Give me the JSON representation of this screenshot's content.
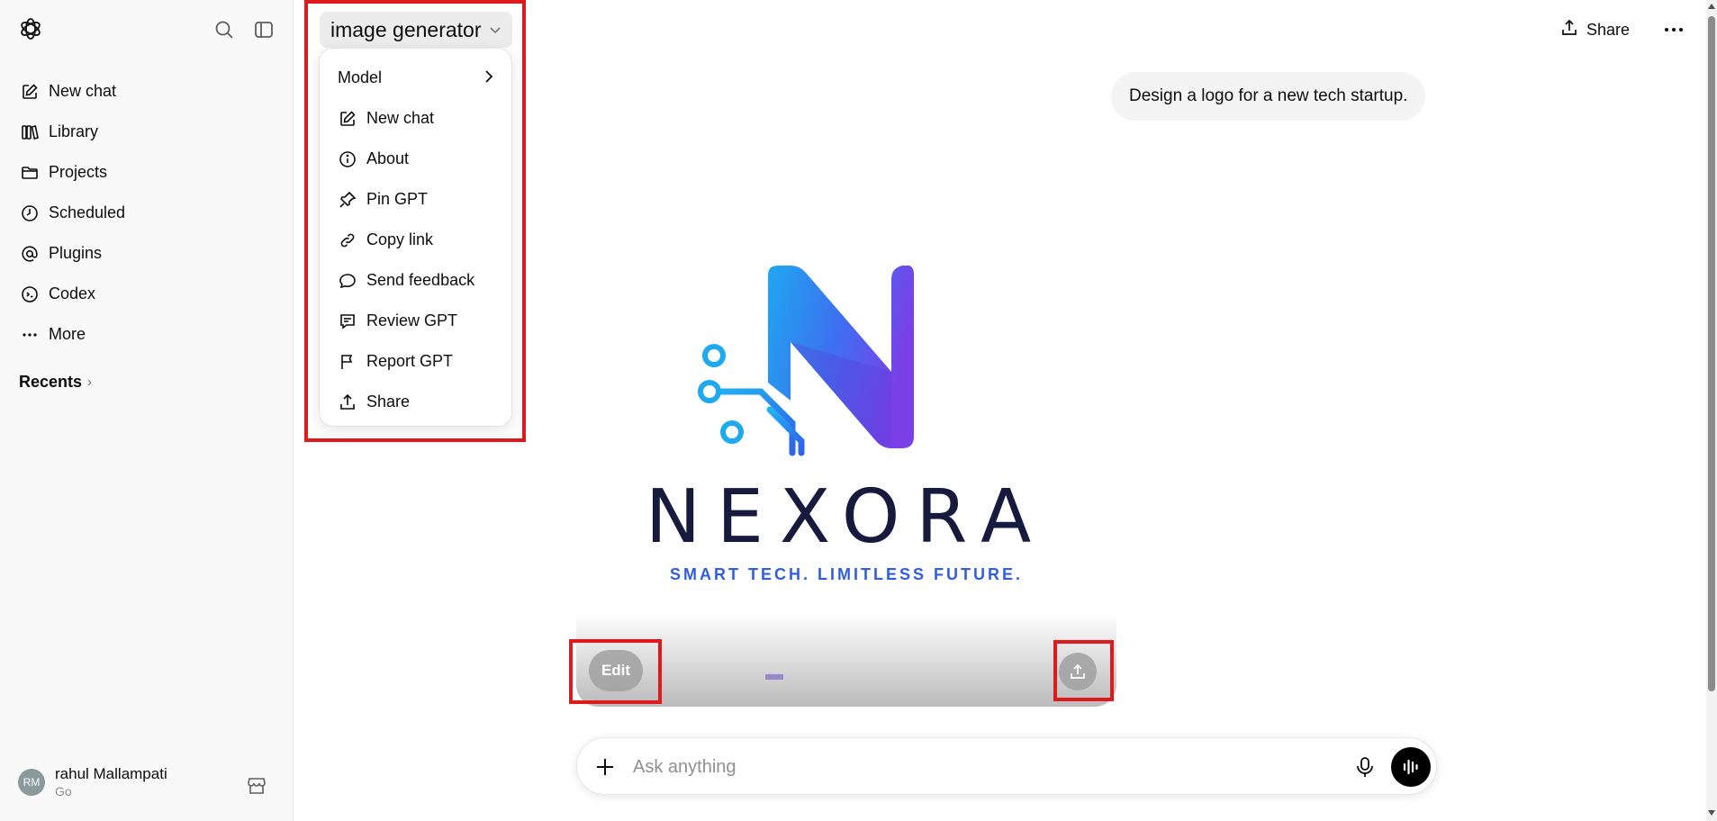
{
  "sidebar": {
    "items": [
      {
        "label": "New chat",
        "icon": "compose-icon"
      },
      {
        "label": "Library",
        "icon": "library-icon"
      },
      {
        "label": "Projects",
        "icon": "folder-icon"
      },
      {
        "label": "Scheduled",
        "icon": "clock-icon"
      },
      {
        "label": "Plugins",
        "icon": "at-icon"
      },
      {
        "label": "Codex",
        "icon": "codex-icon"
      },
      {
        "label": "More",
        "icon": "more-dots-icon"
      }
    ],
    "recents_label": "Recents",
    "user": {
      "initials": "RM",
      "name": "rahul Mallampati",
      "plan": "Go"
    }
  },
  "header": {
    "gpt_title": "image generator",
    "share_label": "Share"
  },
  "menu": {
    "items": [
      {
        "label": "Model",
        "icon": "none"
      },
      {
        "label": "New chat",
        "icon": "compose-icon"
      },
      {
        "label": "About",
        "icon": "info-icon"
      },
      {
        "label": "Pin GPT",
        "icon": "pin-icon"
      },
      {
        "label": "Copy link",
        "icon": "link-icon"
      },
      {
        "label": "Send feedback",
        "icon": "chat-bubble-icon"
      },
      {
        "label": "Review GPT",
        "icon": "review-icon"
      },
      {
        "label": "Report GPT",
        "icon": "flag-icon"
      },
      {
        "label": "Share",
        "icon": "upload-icon"
      }
    ]
  },
  "conversation": {
    "user_message": "Design a logo for a new tech startup.",
    "image": {
      "brand": "NEXORA",
      "tagline": "SMART TECH. LIMITLESS FUTURE.",
      "edit_label": "Edit"
    }
  },
  "composer": {
    "placeholder": "Ask anything"
  },
  "colors": {
    "highlight": "#e0191c",
    "logo_blue": "#1fa7f0",
    "logo_purple": "#7b3fe8",
    "brand_navy": "#161a3d",
    "tagline_blue": "#2f5fe0"
  }
}
